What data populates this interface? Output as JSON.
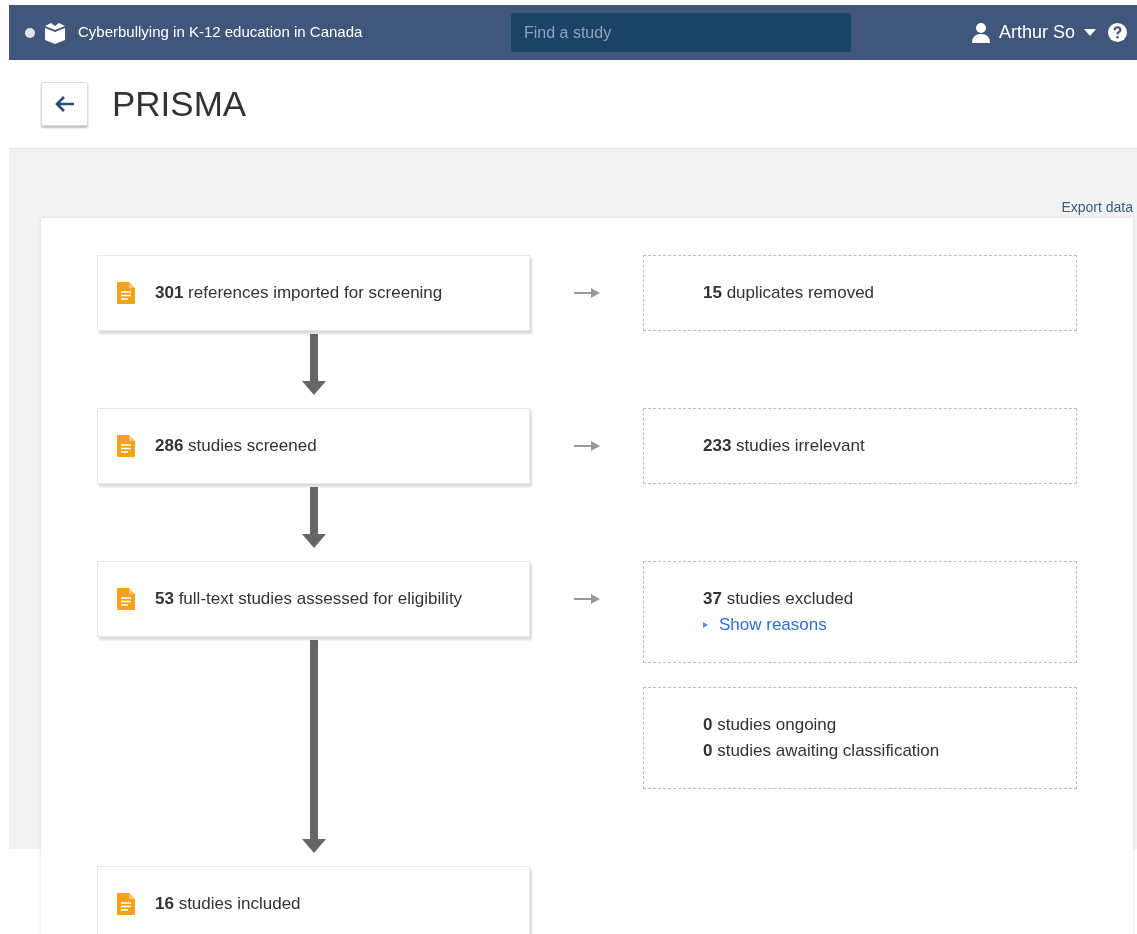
{
  "header": {
    "project_title": "Cyberbullying in K-12 education in Canada",
    "search": {
      "placeholder": "Find a study"
    },
    "user_name": "Arthur So"
  },
  "page_title": "PRISMA",
  "export_link": "Export data",
  "stages": [
    {
      "text": "**301** references imported for screening",
      "outcomes": [
        {
          "lines": [
            "**15** duplicates removed"
          ]
        }
      ]
    },
    {
      "text": "**286** studies screened",
      "outcomes": [
        {
          "lines": [
            "**233** studies irrelevant"
          ]
        }
      ]
    },
    {
      "text": "**53** full-text studies assessed for eligibility",
      "outcomes": [
        {
          "lines": [
            "**37** studies excluded"
          ],
          "link": "Show reasons"
        },
        {
          "lines": [
            "**0** studies ongoing",
            "**0** studies awaiting classification"
          ]
        }
      ]
    },
    {
      "text": "**16** studies included"
    }
  ]
}
